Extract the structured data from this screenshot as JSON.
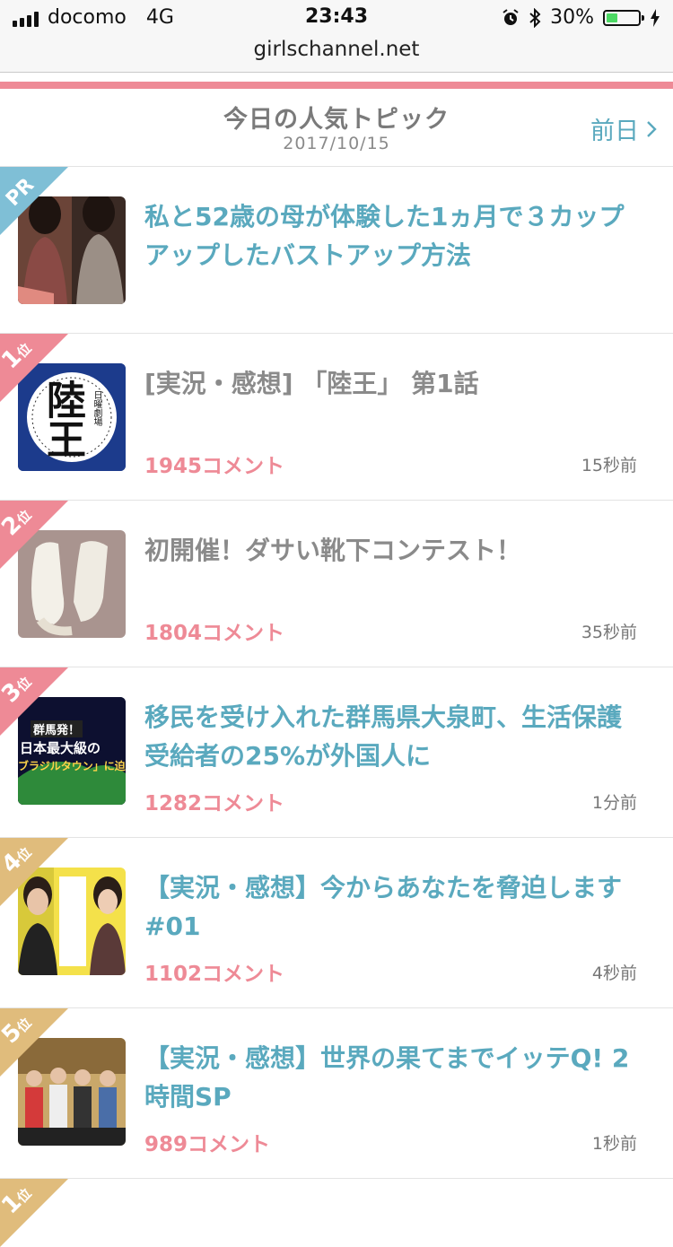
{
  "status_bar": {
    "carrier": "docomo",
    "network": "4G",
    "time": "23:43",
    "battery": "30%"
  },
  "browser": {
    "url": "girlschannel.net"
  },
  "header": {
    "title": "今日の人気トピック",
    "date": "2017/10/15",
    "prev_label": "前日"
  },
  "colors": {
    "accent_pink": "#ee8a96",
    "link_blue": "#5aa9be",
    "rank_gold": "#e0bc7c",
    "pr_blue": "#7fbfd6"
  },
  "topics": [
    {
      "rank_label": "PR",
      "rank_suffix": "",
      "title": "私と52歳の母が体験した1ヵ月で３カップアップしたバストアップ方法",
      "comments": "",
      "time": "",
      "thumb": "women-photo"
    },
    {
      "rank_label": "1",
      "rank_suffix": "位",
      "title": "[実況・感想] 「陸王」 第1話",
      "comments": "1945コメント",
      "time": "15秒前",
      "thumb": "rikuou-logo",
      "thumb_text": "陸王",
      "thumb_sub": "日曜劇場"
    },
    {
      "rank_label": "2",
      "rank_suffix": "位",
      "title": "初開催！ダサい靴下コンテスト！",
      "comments": "1804コメント",
      "time": "35秒前",
      "thumb": "socks-photo"
    },
    {
      "rank_label": "3",
      "rank_suffix": "位",
      "title": "移民を受け入れた群馬県大泉町、生活保護受給者の25%が外国人に",
      "comments": "1282コメント",
      "time": "1分前",
      "thumb": "tv-caption-photo",
      "thumb_text1": "群馬発！",
      "thumb_text2": "日本最大級の",
      "thumb_text3": "ブラジルタウン」に迫る"
    },
    {
      "rank_label": "4",
      "rank_suffix": "位",
      "title": "【実況・感想】今からあなたを脅迫します　#01",
      "comments": "1102コメント",
      "time": "4秒前",
      "thumb": "drama-poster"
    },
    {
      "rank_label": "5",
      "rank_suffix": "位",
      "title": "【実況・感想】世界の果てまでイッテQ! 2時間SP",
      "comments": "989コメント",
      "time": "1秒前",
      "thumb": "variety-show-photo"
    },
    {
      "rank_label": "1",
      "rank_suffix": "位",
      "title": "",
      "comments": "",
      "time": "",
      "thumb": ""
    }
  ]
}
